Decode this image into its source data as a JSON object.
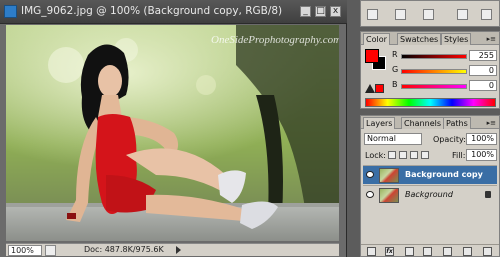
{
  "document": {
    "title": "IMG_9062.jpg @ 100% (Background copy, RGB/8)",
    "watermark": "OneSideProphotography.com",
    "zoom": "100%",
    "doc_info": "Doc: 487.8K/975.6K"
  },
  "window_controls": {
    "minimize": "_",
    "maximize": "□",
    "close": "x"
  },
  "color_panel": {
    "tabs": [
      "Color",
      "Swatches",
      "Styles"
    ],
    "active_tab": "Color",
    "foreground": "#ff0000",
    "background": "#000000",
    "channels": [
      {
        "label": "R",
        "value": "255",
        "level": 1.0
      },
      {
        "label": "G",
        "value": "0",
        "level": 0.0
      },
      {
        "label": "B",
        "value": "0",
        "level": 0.0
      }
    ]
  },
  "layers_panel": {
    "tabs": [
      "Layers",
      "Channels",
      "Paths"
    ],
    "active_tab": "Layers",
    "blend_mode": "Normal",
    "opacity_label": "Opacity:",
    "opacity": "100%",
    "lock_label": "Lock:",
    "fill_label": "Fill:",
    "fill": "100%",
    "layers": [
      {
        "name": "Background copy",
        "selected": true
      },
      {
        "name": "Background",
        "selected": false,
        "locked": true
      }
    ],
    "bottom_icons": [
      "link-icon",
      "fx-icon",
      "mask-icon",
      "adjustment-icon",
      "folder-icon",
      "new-layer-icon",
      "trash-icon"
    ],
    "fx_label": "fx"
  }
}
